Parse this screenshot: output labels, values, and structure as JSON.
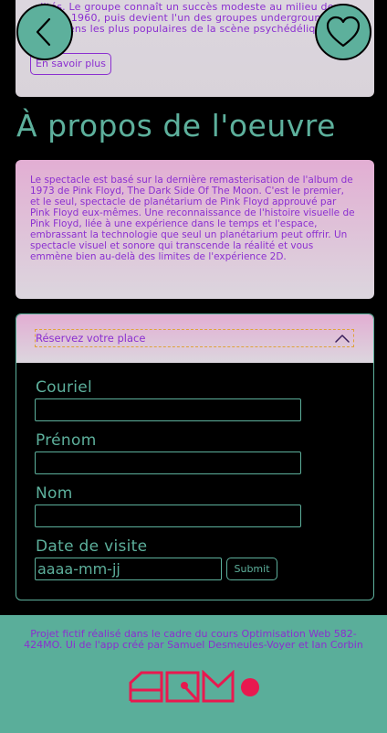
{
  "intro": {
    "text": "…lités. Le groupe connaît un succès modeste au milieu des années 1960, puis devient l'un des groupes underground londoniens les plus populaires de la scène psychédélique.",
    "more_label": "En savoir plus"
  },
  "about": {
    "title": "À propos de l'oeuvre",
    "text": "Le spectacle est basé sur la dernière remasterisation de l'album de 1973 de Pink Floyd, The Dark Side Of The Moon. C'est le premier, et le seul, spectacle de planétarium de Pink Floyd approuvé par Pink Floyd eux-mêmes. Une reconnaissance de l'histoire visuelle de Pink Floyd, liée à une expérience dans le temps et l'espace, embrassant la technologie que seul un planétarium peut offrir. Un spectacle visuel et sonore qui transcende la réalité et vous emmène bien au-delà des limites de l'expérience 2D."
  },
  "reservation": {
    "toggle_label": "Réservez votre place",
    "fields": {
      "email": "Couriel",
      "firstname": "Prénom",
      "lastname": "Nom",
      "date": "Date de visite"
    },
    "date_value": "aaaa-mm-jj",
    "submit_label": "Submit"
  },
  "footer": {
    "text": "Projet fictif réalisé dans le cadre du cours Optimisation Web 582-424MO. Ui de l'app créé par Samuel Desmeules-Voyer et Ian Corbin",
    "logo_text": "ARM"
  },
  "colors": {
    "accent": "#5db09c",
    "text_purple": "#8b2fd0",
    "logo_red": "#e8194f"
  },
  "icons": {
    "back": "chevron-left-icon",
    "favorite": "heart-icon",
    "toggle": "chevron-up-icon"
  }
}
